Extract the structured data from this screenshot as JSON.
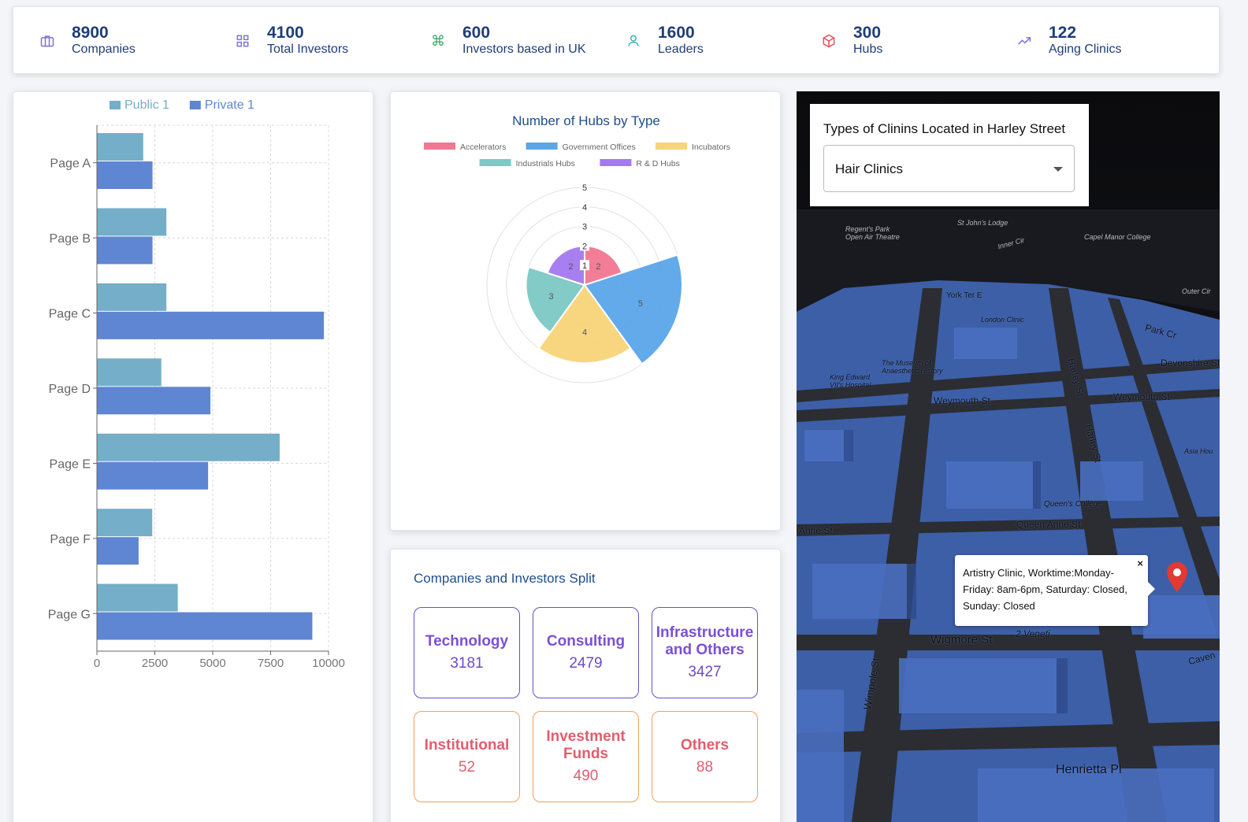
{
  "stats": [
    {
      "value": "8900",
      "label": "Companies",
      "icon": "briefcase-icon",
      "bg": "#ecebfb",
      "fg": "#7b74d8"
    },
    {
      "value": "4100",
      "label": "Total Investors",
      "icon": "grid-icon",
      "bg": "#ecebfb",
      "fg": "#7b74d8"
    },
    {
      "value": "600",
      "label": "Investors based in UK",
      "icon": "command-icon",
      "bg": "#e6f6ec",
      "fg": "#3aa865"
    },
    {
      "value": "1600",
      "label": "Leaders",
      "icon": "user-icon",
      "bg": "#e4f6f8",
      "fg": "#3ab2c2"
    },
    {
      "value": "300",
      "label": "Hubs",
      "icon": "box-icon",
      "bg": "#fbe9ea",
      "fg": "#e0535e"
    },
    {
      "value": "122",
      "label": "Aging Clinics",
      "icon": "trending-up-icon",
      "bg": "#ecebfb",
      "fg": "#7b74d8"
    }
  ],
  "chart_data": [
    {
      "type": "bar",
      "orientation": "horizontal",
      "categories": [
        "Page A",
        "Page B",
        "Page C",
        "Page D",
        "Page E",
        "Page F",
        "Page G"
      ],
      "series": [
        {
          "name": "Public 1",
          "color": "#74aec8",
          "values": [
            2000,
            3000,
            3000,
            2780,
            7890,
            2390,
            3490
          ]
        },
        {
          "name": "Private 1",
          "color": "#5f86d3",
          "values": [
            2400,
            2400,
            9800,
            4900,
            4800,
            1800,
            9300
          ]
        }
      ],
      "xlim": [
        0,
        10000
      ],
      "xticks": [
        "0",
        "2500",
        "5000",
        "7500",
        "10000"
      ],
      "grid": true,
      "legend": "top"
    },
    {
      "type": "polar-area",
      "title": "Number of Hubs by Type",
      "categories": [
        "Accelerators",
        "Government Offices",
        "Incubators",
        "Industrials Hubs",
        "R & D Hubs"
      ],
      "values": [
        2,
        5,
        4,
        3,
        2
      ],
      "colors": [
        "#f17891",
        "#5aa6e8",
        "#f8d479",
        "#7cc9c5",
        "#a479f0"
      ],
      "rlim": [
        0,
        5
      ],
      "rticks": [
        "1",
        "2",
        "3",
        "4",
        "5"
      ],
      "legend": "top"
    }
  ],
  "split": {
    "title": "Companies and Investors Split",
    "tiles": [
      {
        "name": "Technology",
        "value": "3181",
        "style": "blue"
      },
      {
        "name": "Consulting",
        "value": "2479",
        "style": "blue"
      },
      {
        "name": "Infrastructure and Others",
        "value": "3427",
        "style": "blue"
      },
      {
        "name": "Institutional",
        "value": "52",
        "style": "orange"
      },
      {
        "name": "Investment Funds",
        "value": "490",
        "style": "orange"
      },
      {
        "name": "Others",
        "value": "88",
        "style": "orange"
      }
    ]
  },
  "map": {
    "select_title": "Types of Clinins Located in Harley Street",
    "select_value": "Hair Clinics",
    "popup_text": "Artistry Clinic, Worktime:Monday-Friday: 8am-6pm, Saturday: Closed, Sunday: Closed",
    "popup_close": "×",
    "labels": [
      {
        "text": "Regent's Park Open Air Theatre",
        "style": "light"
      },
      {
        "text": "St John's Lodge",
        "style": "light"
      },
      {
        "text": "Capel Manor College",
        "style": "light"
      },
      {
        "text": "Inner Cir",
        "style": "light"
      },
      {
        "text": "Outer Cir",
        "style": "light"
      },
      {
        "text": "York Ter E",
        "style": "dark"
      },
      {
        "text": "London Clinic",
        "style": "dark"
      },
      {
        "text": "Park Cr",
        "style": "dark"
      },
      {
        "text": "Devonshire St",
        "style": "dark"
      },
      {
        "text": "Weymouth St",
        "style": "dark"
      },
      {
        "text": "Weymouth St",
        "style": "dark"
      },
      {
        "text": "Harley St",
        "style": "dark"
      },
      {
        "text": "Harley St",
        "style": "dark"
      },
      {
        "text": "The Museum of Anaesthetic History",
        "style": "dark"
      },
      {
        "text": "King Edward VII's Hospital",
        "style": "dark"
      },
      {
        "text": "Queen's College",
        "style": "dark"
      },
      {
        "text": "Queen Anne St",
        "style": "dark"
      },
      {
        "text": "Anne St",
        "style": "dark"
      },
      {
        "text": "Wigmore St",
        "style": "dark"
      },
      {
        "text": "2 Veneti",
        "style": "dark"
      },
      {
        "text": "Wimpole St",
        "style": "dark"
      },
      {
        "text": "Henrietta Pl",
        "style": "dark"
      },
      {
        "text": "Asia Hou",
        "style": "dark"
      },
      {
        "text": "Caven",
        "style": "dark"
      }
    ]
  }
}
